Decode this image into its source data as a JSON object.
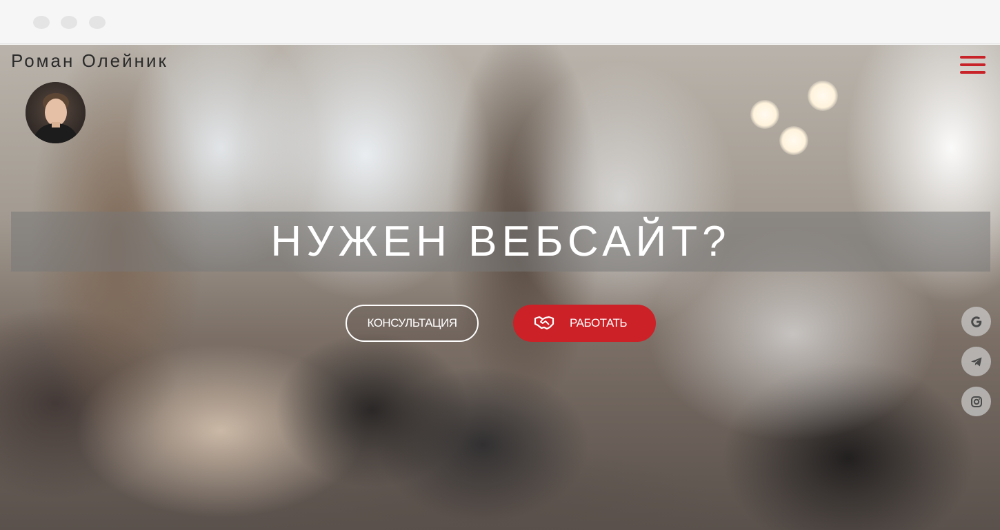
{
  "window": {
    "dots": [
      "dot-1",
      "dot-2",
      "dot-3"
    ]
  },
  "header": {
    "brand_name": "Роман Олейник",
    "menu_icon": "hamburger-menu-icon"
  },
  "hero": {
    "headline": "НУЖЕН ВЕБСАЙТ?",
    "consult_label": "КОНСУЛЬТАЦИЯ",
    "work_label": "РАБОТАТЬ",
    "work_icon": "handshake-icon"
  },
  "social": [
    {
      "name": "google-icon"
    },
    {
      "name": "telegram-icon"
    },
    {
      "name": "instagram-icon"
    }
  ],
  "colors": {
    "accent": "#cc2127",
    "menu": "#c9232a",
    "text_light": "#ffffff",
    "brand_text": "#2b2b2b"
  }
}
